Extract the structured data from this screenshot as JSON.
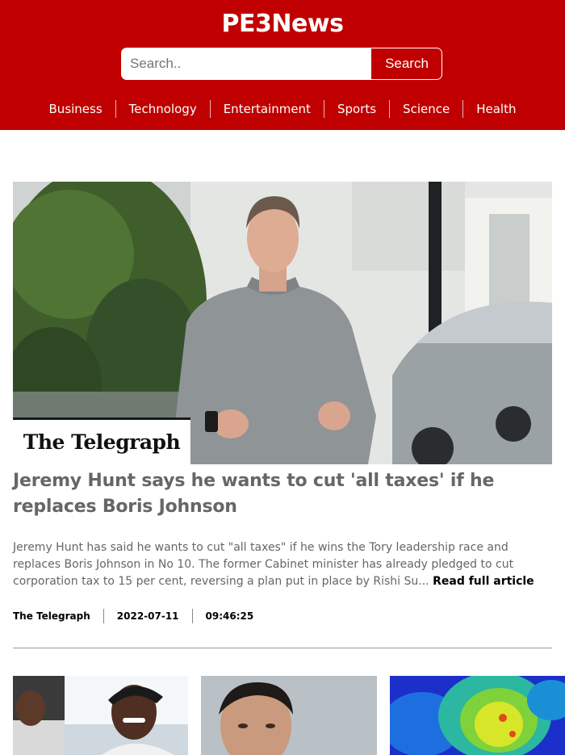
{
  "site": {
    "title": "PE3News"
  },
  "search": {
    "placeholder": "Search..",
    "button_label": "Search"
  },
  "nav": {
    "items": [
      "Business",
      "Technology",
      "Entertainment",
      "Sports",
      "Science",
      "Health"
    ]
  },
  "featured": {
    "source_logo_text": "The Telegraph",
    "headline": "Jeremy Hunt says he wants to cut 'all taxes' if he replaces Boris Johnson",
    "summary": "Jeremy Hunt has said he wants to cut \"all taxes\" if he wins the Tory leadership race and replaces Boris Johnson in No 10. The former Cabinet minister has already pledged to cut corporation tax to 15 per cent, reversing a plan put in place by Rishi Su...",
    "read_more": "Read full article",
    "source": "The Telegraph",
    "date": "2022-07-11",
    "time": "09:46:25"
  },
  "colors": {
    "brand": "#c00000",
    "headline_text": "#666666"
  }
}
